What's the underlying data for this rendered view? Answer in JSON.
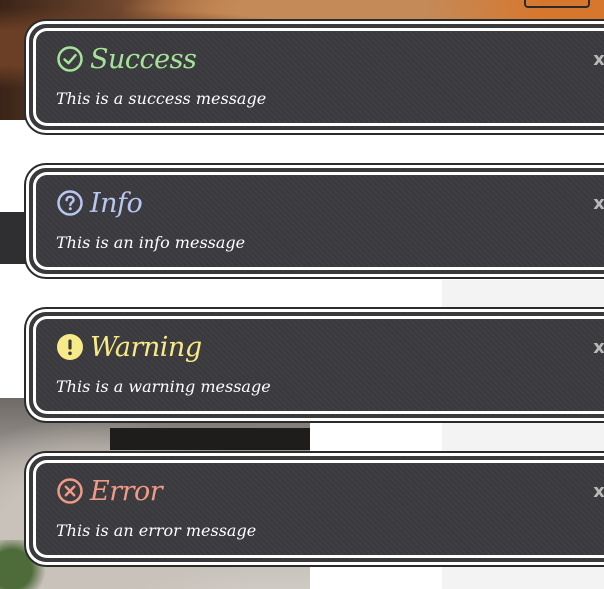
{
  "toasts": {
    "success": {
      "title": "Success",
      "message": "This is a success message",
      "close": "x",
      "icon": "check-circle-icon",
      "color": "#a6e39a"
    },
    "info": {
      "title": "Info",
      "message": "This is an info message",
      "close": "x",
      "icon": "question-circle-icon",
      "color": "#b8c6f2"
    },
    "warning": {
      "title": "Warning",
      "message": "This is a warning message",
      "close": "x",
      "icon": "exclamation-circle-icon",
      "color": "#f7ea88"
    },
    "error": {
      "title": "Error",
      "message": "This is an error message",
      "close": "x",
      "icon": "x-circle-icon",
      "color": "#ee9a86"
    }
  }
}
